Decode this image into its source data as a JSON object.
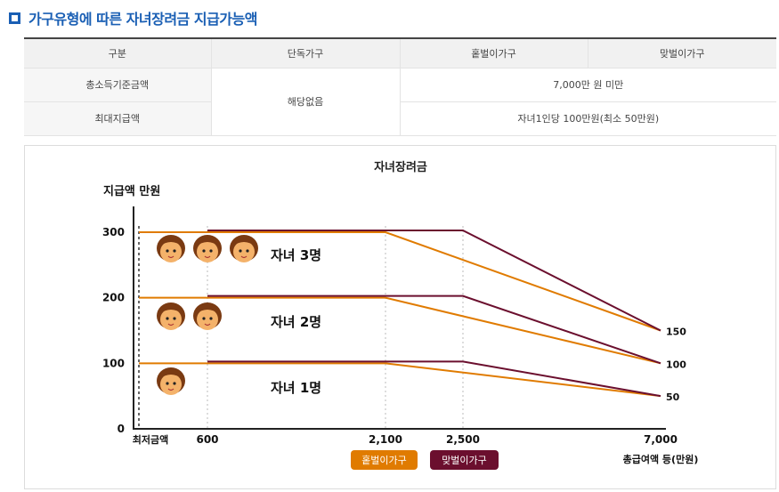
{
  "section_title": "가구유형에 따른 자녀장려금 지급가능액",
  "table": {
    "headers": [
      "구분",
      "단독가구",
      "홑벌이가구",
      "맞벌이가구"
    ],
    "rows": [
      {
        "label": "총소득기준금액",
        "single": "해당없음",
        "value": "7,000만 원 미만"
      },
      {
        "label": "최대지급액",
        "value": "자녀1인당 100만원(최소 50만원)"
      }
    ]
  },
  "chart_data": {
    "type": "line",
    "title": "자녀장려금",
    "ylabel": "지급액 만원",
    "xlabel": "총급여액 등(만원)",
    "x_ticks": [
      "최저금액",
      "600",
      "2,100",
      "2,500",
      "7,000"
    ],
    "y_ticks": [
      "0",
      "100",
      "200",
      "300"
    ],
    "ylim": [
      0,
      300
    ],
    "right_labels": [
      "150",
      "100",
      "50"
    ],
    "series_colors": {
      "single_earner": "#e07b00",
      "dual_earner": "#6b0f2e"
    },
    "series": [
      {
        "name": "홑벌이가구",
        "children": 3,
        "x": [
          0,
          2100,
          7000
        ],
        "y": [
          300,
          300,
          150
        ]
      },
      {
        "name": "맞벌이가구",
        "children": 3,
        "x": [
          600,
          2500,
          7000
        ],
        "y": [
          300,
          300,
          150
        ]
      },
      {
        "name": "홑벌이가구",
        "children": 2,
        "x": [
          0,
          2100,
          7000
        ],
        "y": [
          200,
          200,
          100
        ]
      },
      {
        "name": "맞벌이가구",
        "children": 2,
        "x": [
          600,
          2500,
          7000
        ],
        "y": [
          200,
          200,
          100
        ]
      },
      {
        "name": "홑벌이가구",
        "children": 1,
        "x": [
          0,
          2100,
          7000
        ],
        "y": [
          100,
          100,
          50
        ]
      },
      {
        "name": "맞벌이가구",
        "children": 1,
        "x": [
          600,
          2500,
          7000
        ],
        "y": [
          100,
          100,
          50
        ]
      }
    ],
    "annotations": [
      {
        "text": "자녀 3명",
        "children": 3
      },
      {
        "text": "자녀 2명",
        "children": 2
      },
      {
        "text": "자녀 1명",
        "children": 1
      }
    ],
    "legend": [
      {
        "label": "홑벌이가구",
        "color": "#e07b00"
      },
      {
        "label": "맞벌이가구",
        "color": "#6b0f2e"
      }
    ]
  }
}
